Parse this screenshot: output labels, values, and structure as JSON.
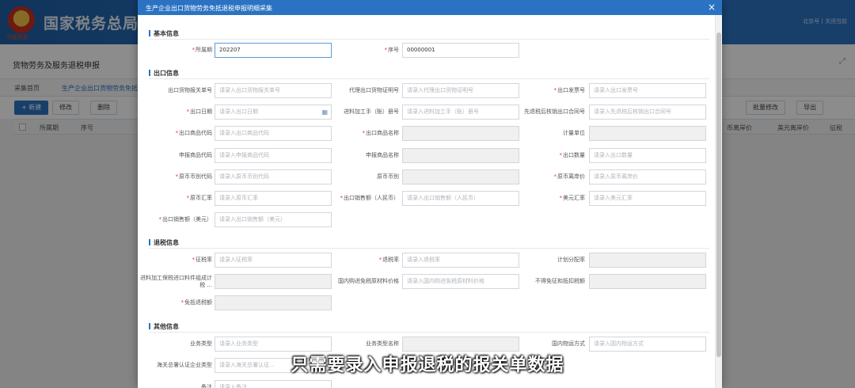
{
  "app": {
    "title": "国家税务总局江",
    "logo_text": "中国税务",
    "header_right": "北京号 | 关闭当前",
    "subbar_title": "货物劳务及服务退税申报",
    "tabs": [
      "采集首页",
      "生产企业出口货物劳务免抵..."
    ],
    "toolbar_left": [
      {
        "label": "+ 新建"
      },
      {
        "label": "修改"
      },
      {
        "label": "删除"
      }
    ],
    "toolbar_right": [
      {
        "label": "批量修改"
      },
      {
        "label": "导出"
      }
    ],
    "table_headers_left": [
      "所属期",
      "序号"
    ],
    "table_headers_right": [
      "币离岸价",
      "美元离岸价",
      "征税"
    ]
  },
  "modal": {
    "title": "生产企业出口货物劳务免抵退税申报明细采集",
    "close_icon": "close-icon",
    "sections": {
      "basic": "基本信息",
      "export": "出口信息",
      "refund": "退税信息",
      "other": "其他信息"
    },
    "basic": [
      {
        "label": "所属期",
        "required": "*",
        "value": "202207",
        "placeholder": ""
      },
      {
        "label": "序号",
        "required": "*",
        "value": "00000001",
        "placeholder": ""
      }
    ],
    "export": [
      {
        "label": "出口货物报关单号",
        "required": "",
        "placeholder": "请录入出口货物报关单号"
      },
      {
        "label": "代理出口货物证明号",
        "required": "",
        "placeholder": "请录入代理出口货物证明号"
      },
      {
        "label": "出口发票号",
        "required": "*",
        "placeholder": "请录入出口发票号"
      },
      {
        "label": "出口日期",
        "required": "*",
        "placeholder": "请录入出口日期"
      },
      {
        "label": "进料加工手（账）册号",
        "required": "",
        "placeholder": "请录入进料加工手（账）册号"
      },
      {
        "label": "先退税后核销出口合同号",
        "required": "",
        "placeholder": "请录入先退税后核销出口合同号"
      },
      {
        "label": "出口商品代码",
        "required": "*",
        "placeholder": "请录入出口商品代码"
      },
      {
        "label": "出口商品名称",
        "required": "*",
        "placeholder": ""
      },
      {
        "label": "计量单位",
        "required": "",
        "placeholder": ""
      },
      {
        "label": "申报商品代码",
        "required": "",
        "placeholder": "请录入申报商品代码"
      },
      {
        "label": "申报商品名称",
        "required": "",
        "placeholder": ""
      },
      {
        "label": "出口数量",
        "required": "*",
        "placeholder": "请录入出口数量"
      },
      {
        "label": "原币币别代码",
        "required": "*",
        "placeholder": "请录入原币币别代码"
      },
      {
        "label": "原币币别",
        "required": "",
        "placeholder": ""
      },
      {
        "label": "原币离岸价",
        "required": "*",
        "placeholder": "请录入原币离岸价"
      },
      {
        "label": "原币汇率",
        "required": "*",
        "placeholder": "请录入原币汇率"
      },
      {
        "label": "出口销售额（人民币）",
        "required": "*",
        "placeholder": "请录入出口销售额（人民币）"
      },
      {
        "label": "美元汇率",
        "required": "*",
        "placeholder": "请录入美元汇率"
      },
      {
        "label": "出口销售额（美元）",
        "required": "*",
        "placeholder": "请录入出口销售额（美元）"
      }
    ],
    "refund": [
      {
        "label": "征税率",
        "required": "*",
        "placeholder": "请录入征税率"
      },
      {
        "label": "退税率",
        "required": "*",
        "placeholder": "请录入退税率"
      },
      {
        "label": "计划分配率",
        "required": "",
        "placeholder": ""
      },
      {
        "label": "进料加工保税进口料件组成计税 ...",
        "required": "",
        "placeholder": ""
      },
      {
        "label": "国内购进免税原材料价格",
        "required": "",
        "placeholder": "请录入国内购进免税原材料价格"
      },
      {
        "label": "不得免征和抵扣税额",
        "required": "",
        "placeholder": ""
      },
      {
        "label": "免抵退税额",
        "required": "*",
        "placeholder": ""
      }
    ],
    "other": [
      {
        "label": "业务类型",
        "required": "",
        "placeholder": "请录入业务类型"
      },
      {
        "label": "业务类型名称",
        "required": "",
        "placeholder": ""
      },
      {
        "label": "国内物运方式",
        "required": "",
        "placeholder": "请录入国内物运方式"
      },
      {
        "label": "海关总署认证企业类型",
        "required": "",
        "placeholder": "请录入海关总署认证..."
      },
      {
        "label": "备注",
        "required": "",
        "placeholder": "请录入备注"
      }
    ]
  },
  "caption": "只需要录入申报退税的报关单数据"
}
